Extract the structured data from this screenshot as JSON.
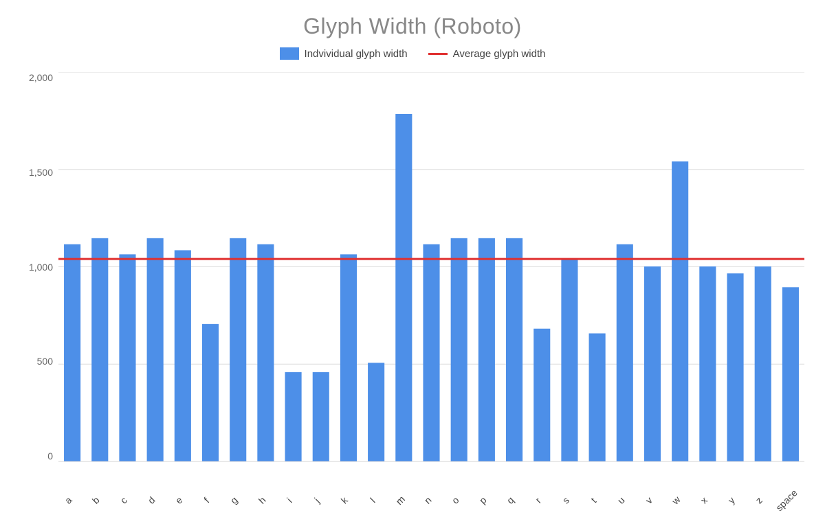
{
  "title": "Glyph Width (Roboto)",
  "legend": {
    "bar_label": "Indvividual glyph width",
    "line_label": "Average glyph width"
  },
  "y_ticks": [
    2000,
    1500,
    1000,
    500,
    0
  ],
  "average": 1040,
  "max_value": 2000,
  "bars": [
    {
      "label": "a",
      "value": 1116
    },
    {
      "label": "b",
      "value": 1147
    },
    {
      "label": "c",
      "value": 1064
    },
    {
      "label": "d",
      "value": 1147
    },
    {
      "label": "e",
      "value": 1085
    },
    {
      "label": "f",
      "value": 706
    },
    {
      "label": "g",
      "value": 1147
    },
    {
      "label": "h",
      "value": 1116
    },
    {
      "label": "i",
      "value": 459
    },
    {
      "label": "j",
      "value": 459
    },
    {
      "label": "k",
      "value": 1064
    },
    {
      "label": "l",
      "value": 507
    },
    {
      "label": "m",
      "value": 1785
    },
    {
      "label": "n",
      "value": 1116
    },
    {
      "label": "o",
      "value": 1147
    },
    {
      "label": "p",
      "value": 1147
    },
    {
      "label": "q",
      "value": 1147
    },
    {
      "label": "r",
      "value": 682
    },
    {
      "label": "s",
      "value": 1043
    },
    {
      "label": "t",
      "value": 658
    },
    {
      "label": "u",
      "value": 1116
    },
    {
      "label": "v",
      "value": 1002
    },
    {
      "label": "w",
      "value": 1541
    },
    {
      "label": "x",
      "value": 1002
    },
    {
      "label": "y",
      "value": 966
    },
    {
      "label": "z",
      "value": 1002
    },
    {
      "label": "space",
      "value": 895
    }
  ],
  "colors": {
    "bar": "#4d8fe8",
    "average_line": "#e03030",
    "grid": "#dddddd",
    "axis_text": "#666666"
  }
}
